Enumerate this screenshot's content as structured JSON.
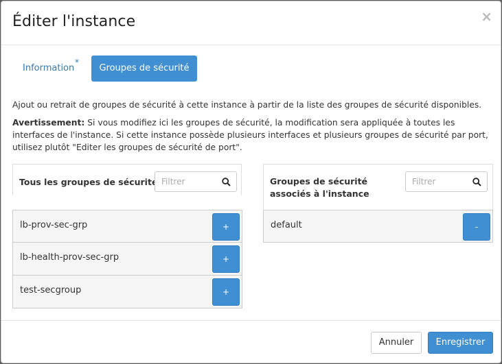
{
  "modal": {
    "title": "Éditer l'instance",
    "close_label": "×"
  },
  "tabs": [
    {
      "label": "Information",
      "required_mark": "*"
    },
    {
      "label": "Groupes de sécurité"
    }
  ],
  "description": "Ajout ou retrait de groupes de sécurité à cette instance à partir de la liste des groupes de sécurité disponibles.",
  "warning": {
    "label": "Avertissement:",
    "text": " Si vous modifiez ici les groupes de sécurité, la modification sera appliquée à toutes les interfaces de l'instance. Si cette instance possède plusieurs interfaces et plusieurs groupes de sécurité par port, utilisez plutôt \"Editer les groupes de sécurité de port\"."
  },
  "available_panel": {
    "title": "Tous les groupes de sécurité",
    "filter_placeholder": "Filtrer",
    "items": [
      {
        "name": "lb-prov-sec-grp",
        "action": "+"
      },
      {
        "name": "lb-health-prov-sec-grp",
        "action": "+"
      },
      {
        "name": "test-secgroup",
        "action": "+"
      }
    ]
  },
  "assigned_panel": {
    "title": "Groupes de sécurité associés à l'instance",
    "filter_placeholder": "Filtrer",
    "items": [
      {
        "name": "default",
        "action": "-"
      }
    ]
  },
  "footer": {
    "cancel_label": "Annuler",
    "save_label": "Enregistrer"
  },
  "colors": {
    "accent": "#3f8fd2",
    "link": "#337ab7"
  },
  "icons": {
    "close": "close-icon",
    "search": "search-icon"
  }
}
